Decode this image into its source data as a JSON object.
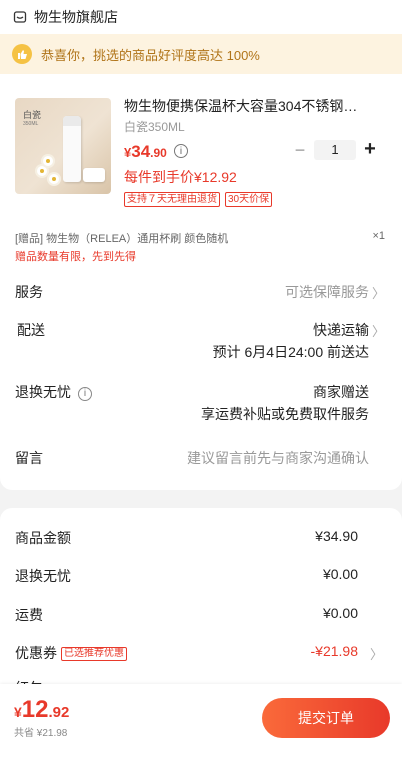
{
  "store": {
    "name": "物生物旗舰店"
  },
  "banner": {
    "text": "恭喜你，挑选的商品好评度高达 100%"
  },
  "product": {
    "image_brand": "白瓷",
    "image_sub": "350ML",
    "title": "物生物便携保温杯大容量304不锈钢…",
    "spec": "白瓷350ML",
    "price_yen": "¥",
    "price_int": "34",
    "price_dec": ".90",
    "info_icon": "i",
    "minus": "−",
    "quantity": "1",
    "plus": "+",
    "hand_price": "每件到手价¥12.92",
    "tags": [
      "支持７天无理由退货",
      "30天价保"
    ]
  },
  "gift": {
    "text": "[赠品] 物生物（RELEA）通用杯刷 颜色随机",
    "qty": "×1",
    "note": "赠品数量有限，先到先得"
  },
  "options": {
    "service": {
      "label": "服务",
      "value": "可选保障服务",
      "chevron": "〉"
    },
    "delivery": {
      "label": "配送",
      "value": "快递运输",
      "estimate": "预计 6月4日24:00 前送达",
      "chevron": "〉"
    },
    "returns": {
      "label": "退换无忧",
      "info_icon": "i",
      "value": "商家赠送",
      "detail": "享运费补贴或免费取件服务"
    },
    "message": {
      "label": "留言",
      "placeholder": "建议留言前先与商家沟通确认"
    }
  },
  "summary": {
    "goods_amount": {
      "label": "商品金额",
      "value": "¥34.90"
    },
    "returns": {
      "label": "退换无忧",
      "value": "¥0.00"
    },
    "shipping": {
      "label": "运费",
      "value": "¥0.00"
    },
    "coupon": {
      "label": "优惠券",
      "tag": "已选推荐优惠",
      "value": "-¥21.98",
      "chevron": "〉"
    },
    "partial_label": "红包"
  },
  "bottom": {
    "total_yen": "¥",
    "total_int": "12",
    "total_dec": ".92",
    "discount_text": "共省 ¥21.98",
    "submit_label": "提交订单"
  },
  "colors": {
    "accent": "#e8392a",
    "banner_bg": "#fdf3e0",
    "banner_text": "#b07418"
  }
}
